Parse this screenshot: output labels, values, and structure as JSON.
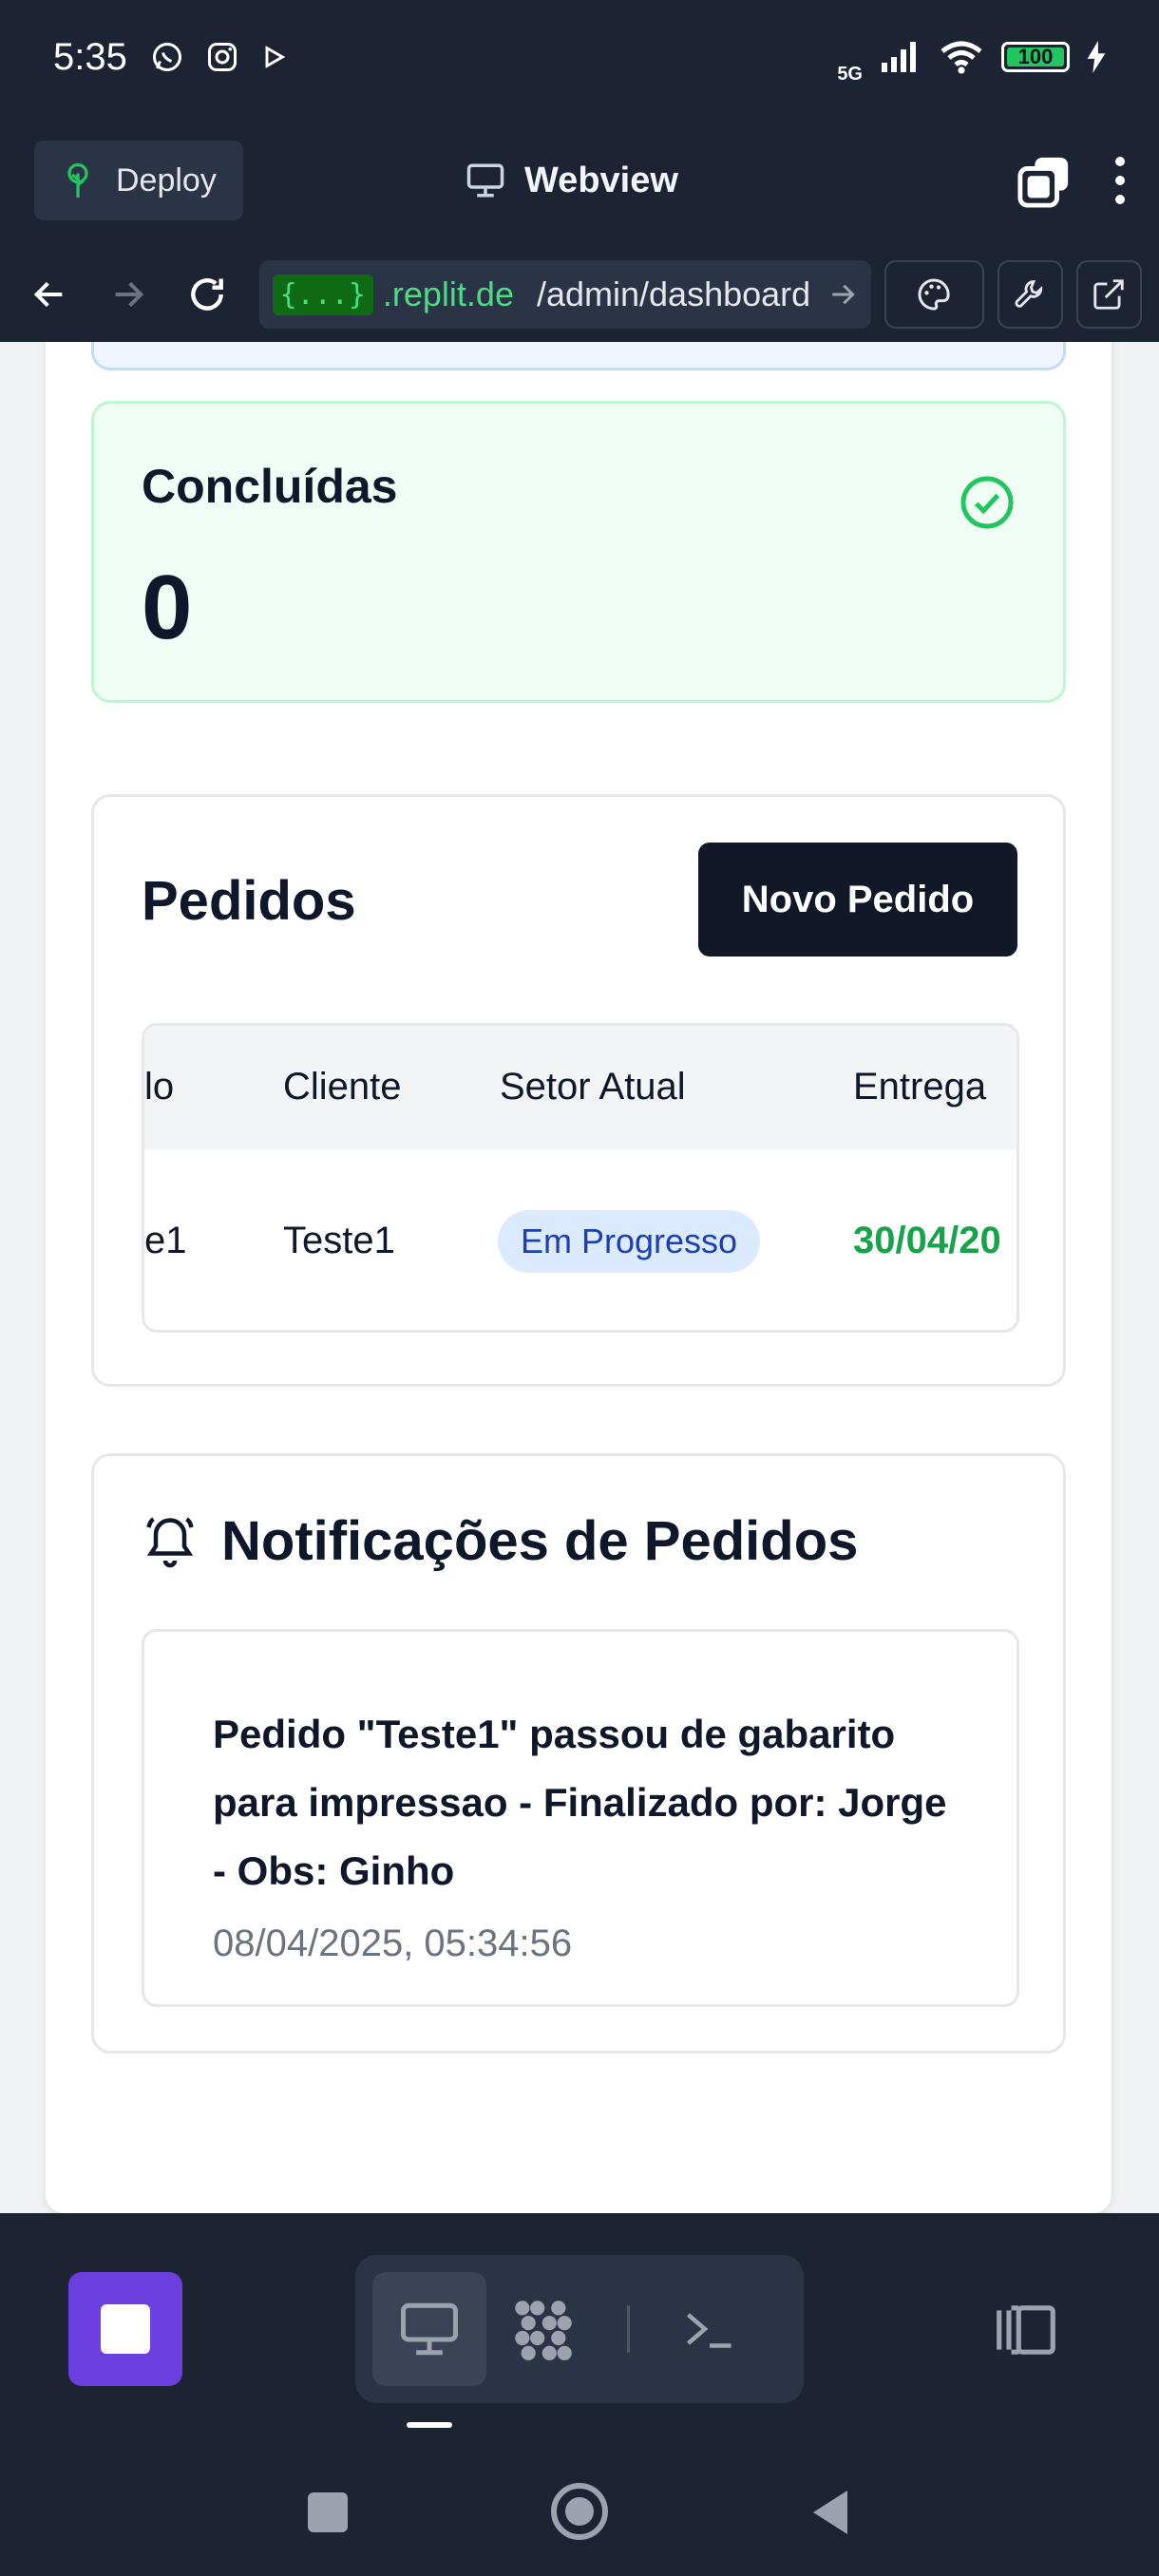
{
  "status_bar": {
    "time": "5:35",
    "network": "5G",
    "battery": "100"
  },
  "header": {
    "deploy_label": "Deploy",
    "title": "Webview"
  },
  "url_bar": {
    "badge": "{...}",
    "domain": ".replit.de",
    "path": "/admin/dashboard"
  },
  "completed_card": {
    "title": "Concluídas",
    "count": "0"
  },
  "orders": {
    "title": "Pedidos",
    "new_order_label": "Novo Pedido",
    "columns": [
      "lo",
      "Cliente",
      "Setor Atual",
      "Entrega"
    ],
    "rows": [
      {
        "order": "e1",
        "client": "Teste1",
        "sector": "Em Progresso",
        "delivery": "30/04/20"
      }
    ]
  },
  "notifications": {
    "title": "Notificações de Pedidos",
    "items": [
      {
        "message": "Pedido \"Teste1\" passou de gabarito para impressao - Finalizado por: Jorge - Obs: Ginho",
        "timestamp": "08/04/2025, 05:34:56"
      }
    ]
  },
  "colors": {
    "brand_purple": "#6d3fe0",
    "success_green": "#16a34a",
    "badge_blue": "#1e40af"
  }
}
